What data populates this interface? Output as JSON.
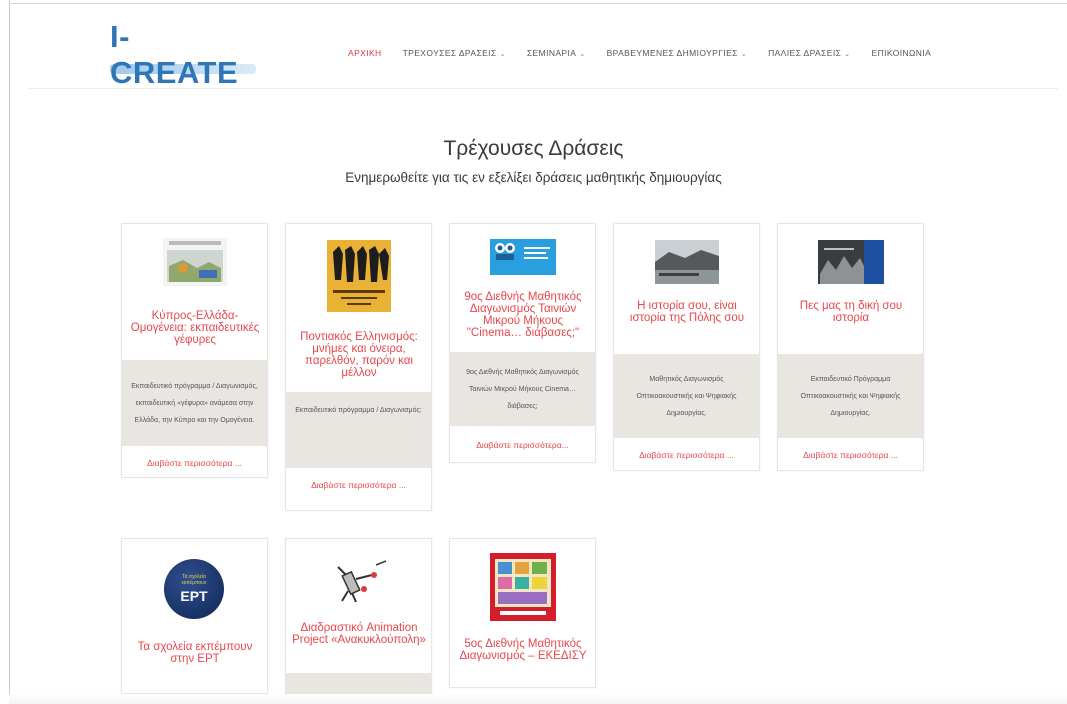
{
  "header": {
    "logo_text": "I-CREATE",
    "nav": [
      {
        "label": "ΑΡΧΙΚΗ",
        "has_dropdown": false,
        "active": true
      },
      {
        "label": "ΤΡΕΧΟΥΣΕΣ ΔΡΑΣΕΙΣ",
        "has_dropdown": true,
        "active": false
      },
      {
        "label": "ΣΕΜΙΝΑΡΙΑ",
        "has_dropdown": true,
        "active": false
      },
      {
        "label": "ΒΡΑΒΕΥΜΕΝΕΣ ΔΗΜΙΟΥΡΓΙΕΣ",
        "has_dropdown": true,
        "active": false
      },
      {
        "label": "ΠΑΛΙΕΣ ΔΡΑΣΕΙΣ",
        "has_dropdown": true,
        "active": false
      },
      {
        "label": "ΕΠΙΚΟΙΝΩΝΙΑ",
        "has_dropdown": false,
        "active": false
      }
    ],
    "caret": "⌄"
  },
  "main": {
    "title": "Τρέχουσες Δράσεις",
    "subtitle": "Ενημερωθείτε για τις εν εξελίξει δράσεις μαθητικής δημιουργίας"
  },
  "cards": [
    {
      "title": "Κύπρος-Ελλάδα-Ομογένεια: εκπαιδευτικές γέφυρες",
      "desc": "Εκπαιδευτικό πρόγραμμα / Διαγωνισμός, εκπαιδευτική «γέφυρα» ανάμεσα στην Ελλάδα, την Κύπρο και την Ομογένεια.",
      "more": "Διαβάστε περισσότερα ..."
    },
    {
      "title": "Ποντιακός Ελληνισμός: μνήμες και όνειρα, παρελθόν, παρόν και μέλλον",
      "desc": "Εκπαιδευτικό πρόγραμμα / Διαγωνισμός:",
      "more": "Διαβάστε περισσότερα ..."
    },
    {
      "title": "9ος Διεθνής Μαθητικός Διαγωνισμός Ταινιών Μικρού Μήκους \"Cinema… διάβασες;\"",
      "desc": "9ος Διεθνής Μαθητικός Διαγωνισμός Ταινιών Μικρού Μήκους Cinema… διάβασες;",
      "more": "Διαβάστε περισσότερα..."
    },
    {
      "title": "Η ιστορία σου, είναι ιστορία της Πόλης σου",
      "desc": "Μαθητικός Διαγωνισμός Οπτικοακουστικής και Ψηφιακής Δημιουργίας.",
      "more": "Διαβάστε περισσότερα ..."
    },
    {
      "title": "Πες μας τη δική σου ιστορία",
      "desc": "Εκπαιδευτικό Πρόγραμμα Οπτικοακουστικής και Ψηφιακής Δημιουργίας.",
      "more": "Διαβάστε περισσότερα ..."
    },
    {
      "title": "Τα σχολεία εκπέμπουν στην ΕΡΤ",
      "logo_text": "ΕΡΤ",
      "logo_small": "Τα σχολεία εκπέμπουν"
    },
    {
      "title": "Διαδραστικό Animation Project «Ανακυκλούπολη»"
    },
    {
      "title": "5ος Διεθνής Μαθητικός Διαγωνισμός – ΕΚΕΔΙΣΥ"
    }
  ],
  "colors": {
    "accent": "#e8474b",
    "logo_blue": "#2f76b8",
    "desc_bg": "#e9e6e2"
  }
}
